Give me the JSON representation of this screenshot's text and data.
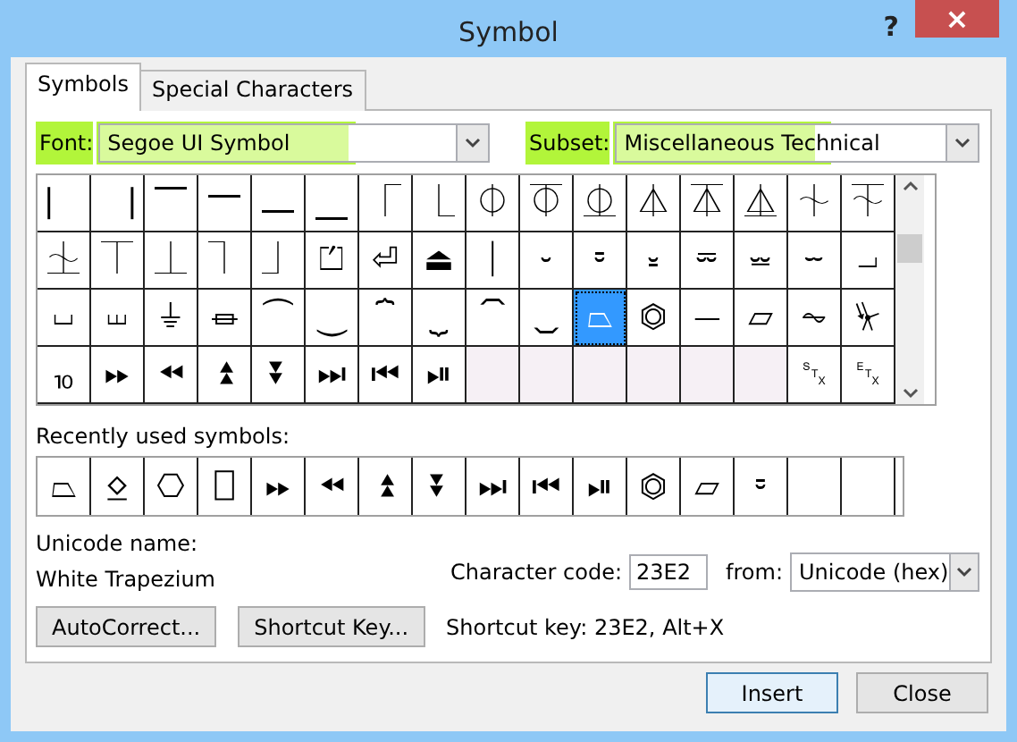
{
  "window": {
    "title": "Symbol",
    "help": "?",
    "close": "×"
  },
  "tabs": [
    {
      "label": "Symbols",
      "selected": true
    },
    {
      "label": "Special Characters",
      "selected": false
    }
  ],
  "font": {
    "label": "Font:",
    "value": "Segoe UI Symbol",
    "highlighted": true
  },
  "subset": {
    "label": "Subset:",
    "value": "Miscellaneous Technical",
    "highlighted": true
  },
  "symbols": [
    [
      {
        "char": "⎸",
        "selected": false
      },
      {
        "char": "⎹",
        "selected": false
      },
      {
        "char": "⎺",
        "selected": false
      },
      {
        "char": "⎻",
        "selected": false
      },
      {
        "char": "⎼",
        "selected": false
      },
      {
        "char": "⎽",
        "selected": false
      },
      {
        "char": "⎾",
        "selected": false
      },
      {
        "char": "⎿",
        "selected": false
      },
      {
        "char": "⏀",
        "selected": false
      },
      {
        "char": "⏁",
        "selected": false
      },
      {
        "char": "⏂",
        "selected": false
      },
      {
        "char": "⏃",
        "selected": false
      },
      {
        "char": "⏄",
        "selected": false
      },
      {
        "char": "⏅",
        "selected": false
      },
      {
        "char": "⏆",
        "selected": false
      },
      {
        "char": "⏇",
        "selected": false
      }
    ],
    [
      {
        "char": "⏈",
        "selected": false
      },
      {
        "char": "⏉",
        "selected": false
      },
      {
        "char": "⏊",
        "selected": false
      },
      {
        "char": "⏋",
        "selected": false
      },
      {
        "char": "⏌",
        "selected": false
      },
      {
        "char": "⏍",
        "selected": false
      },
      {
        "char": "⏎",
        "selected": false
      },
      {
        "char": "⏏",
        "selected": false
      },
      {
        "char": "⏐",
        "selected": false
      },
      {
        "char": "⏑",
        "selected": false
      },
      {
        "char": "⏒",
        "selected": false
      },
      {
        "char": "⏓",
        "selected": false
      },
      {
        "char": "⏔",
        "selected": false
      },
      {
        "char": "⏕",
        "selected": false
      },
      {
        "char": "⏖",
        "selected": false
      },
      {
        "char": "⏗",
        "selected": false
      }
    ],
    [
      {
        "char": "⏘",
        "selected": false
      },
      {
        "char": "⏙",
        "selected": false
      },
      {
        "char": "⏚",
        "selected": false
      },
      {
        "char": "⏛",
        "selected": false
      },
      {
        "char": "⏜",
        "selected": false
      },
      {
        "char": "⏝",
        "selected": false
      },
      {
        "char": "⏞",
        "selected": false
      },
      {
        "char": "⏟",
        "selected": false
      },
      {
        "char": "⏠",
        "selected": false
      },
      {
        "char": "⏡",
        "selected": false
      },
      {
        "char": "⏢",
        "selected": true
      },
      {
        "char": "⏣",
        "selected": false
      },
      {
        "char": "⏤",
        "selected": false
      },
      {
        "char": "⏥",
        "selected": false
      },
      {
        "char": "⏦",
        "selected": false
      },
      {
        "char": "⏧",
        "selected": false
      }
    ],
    [
      {
        "char": "⏨",
        "selected": false
      },
      {
        "char": "⏩",
        "selected": false
      },
      {
        "char": "⏪",
        "selected": false
      },
      {
        "char": "⏫",
        "selected": false
      },
      {
        "char": "⏬",
        "selected": false
      },
      {
        "char": "⏭",
        "selected": false
      },
      {
        "char": "⏮",
        "selected": false
      },
      {
        "char": "⏯",
        "selected": false
      },
      {
        "kind": "empty"
      },
      {
        "kind": "empty"
      },
      {
        "kind": "empty"
      },
      {
        "kind": "empty"
      },
      {
        "kind": "empty"
      },
      {
        "kind": "empty"
      },
      {
        "char": "␂",
        "selected": false
      },
      {
        "char": "␃",
        "selected": false
      }
    ]
  ],
  "recent": {
    "label": "Recently used symbols:",
    "symbols": [
      "⏢",
      "⍚",
      "⎔",
      "⎕",
      "⏩",
      "⏪",
      "⏫",
      "⏬",
      "⏭",
      "⏮",
      "⏯",
      "⏣",
      "⏥",
      "⏒"
    ]
  },
  "unicode_name": {
    "label": "Unicode name:",
    "value": "White Trapezium"
  },
  "character_code": {
    "label": "Character code:",
    "value": "23E2"
  },
  "from": {
    "label": "from:",
    "value": "Unicode (hex)"
  },
  "autocorrect_button": "AutoCorrect...",
  "shortcut_key_button": "Shortcut Key...",
  "shortcut_key_text": "Shortcut key: 23E2, Alt+X",
  "buttons": [
    {
      "label": "Insert",
      "default": true
    },
    {
      "label": "Close",
      "default": false
    }
  ]
}
